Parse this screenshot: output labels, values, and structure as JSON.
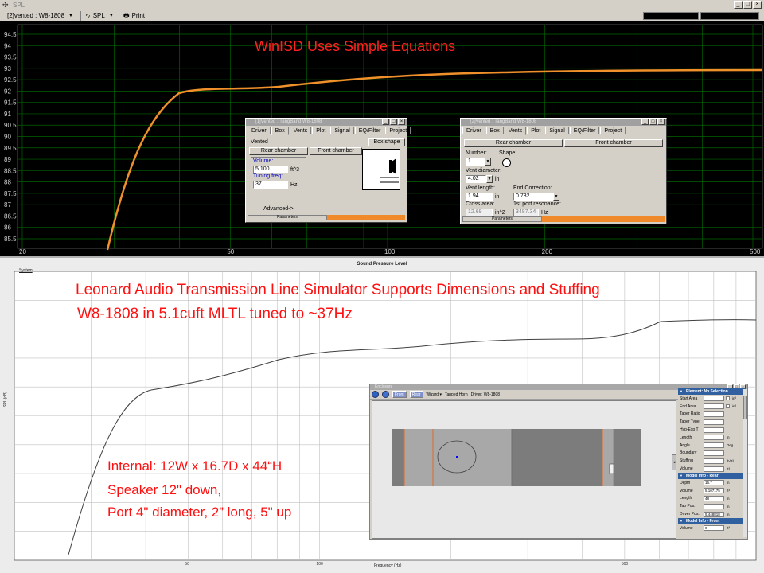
{
  "winisd": {
    "window_title": "SPL",
    "toolbar": {
      "project_combo": "[2]vented : W8-1808",
      "graph_combo": "SPL",
      "print_label": "Print"
    },
    "heading": "WinISD Uses Simple Equations",
    "plot": {
      "y_ticks": [
        "94.5",
        "94",
        "93.5",
        "93",
        "92.5",
        "92",
        "91.5",
        "91",
        "90.5",
        "90",
        "89.5",
        "89",
        "88.5",
        "88",
        "87.5",
        "87",
        "86.5",
        "86",
        "85.5"
      ],
      "x_ticks": [
        "20",
        "50",
        "100",
        "200",
        "500"
      ]
    },
    "dialog1": {
      "title": "[1]Vented : TangBand W8-1808",
      "tabs": [
        "Driver",
        "Box",
        "Vents",
        "Plot",
        "Signal",
        "EQ/Filter",
        "Project"
      ],
      "active_tab": "Box",
      "box_type": "Vented",
      "box_shape_button": "Box shape",
      "rear_chamber": "Rear chamber",
      "front_chamber": "Front chamber",
      "volume_label": "Volume:",
      "volume_value": "5.100",
      "volume_unit": "ft^3",
      "tuning_label": "Tuning freq:",
      "tuning_value": "37",
      "tuning_unit": "Hz",
      "advanced_button": "Advanced->",
      "status": "Parameters"
    },
    "dialog2": {
      "title": "[2]Vented : TangBand W8-1808",
      "tabs": [
        "Driver",
        "Box",
        "Vents",
        "Plot",
        "Signal",
        "EQ/Filter",
        "Project"
      ],
      "active_tab": "Vents",
      "rear_chamber": "Rear chamber",
      "front_chamber": "Front chamber",
      "number_label": "Number:",
      "number_value": "1",
      "shape_label": "Shape:",
      "vent_diameter_label": "Vent diameter:",
      "vent_diameter_value": "4.02",
      "vent_diameter_unit": "in",
      "vent_length_label": "Vent length:",
      "vent_length_value": "1.94",
      "vent_length_unit": "in",
      "end_correction_label": "End Correction:",
      "end_correction_value": "0.732",
      "cross_area_label": "Cross area:",
      "cross_area_value": "12.69",
      "cross_area_unit": "in^2",
      "port_resonance_label": "1st port resonance:",
      "port_resonance_value": "3487.34",
      "port_resonance_unit": "Hz",
      "status": "Parameters"
    }
  },
  "leonard": {
    "chart_title": "Sound Pressure Level",
    "system_label": "System",
    "heading_line1": "Leonard Audio Transmission Line Simulator Supports Dimensions and Stuffing",
    "heading_line2": "W8-1808 in 5.1cuft MLTL tuned to ~37Hz",
    "spec_lines": [
      "Internal: 12W x 16.7D x 44“H",
      "Speaker 12\" down,",
      "Port 4\" diameter, 2” long, 5\" up"
    ],
    "y_axis_label": "SPL (dB)",
    "x_axis_label": "Frequency (Hz)",
    "x_ticks": [
      "50",
      "100",
      "500"
    ],
    "enclosure": {
      "window_title": "Enclosure",
      "toolbar": [
        "Front",
        "Rear",
        "Wizard",
        "Tapped Horn",
        "Driver: W8-1808"
      ],
      "active_buttons": [
        "Front",
        "Rear"
      ],
      "element_header": "Element: No Selection",
      "element_rows": [
        {
          "k": "Start Area",
          "v": "",
          "u": "in²"
        },
        {
          "k": "End Area",
          "v": "",
          "u": "in²"
        },
        {
          "k": "Taper Ratio",
          "v": "",
          "u": ""
        },
        {
          "k": "Taper Type",
          "v": "",
          "u": ""
        },
        {
          "k": "Hyp-Exp T",
          "v": "",
          "u": ""
        },
        {
          "k": "Length",
          "v": "",
          "u": "in"
        },
        {
          "k": "Angle",
          "v": "",
          "u": "Deg"
        },
        {
          "k": "Boundary",
          "v": "",
          "u": ""
        },
        {
          "k": "Stuffing",
          "v": "",
          "u": "lb/ft³"
        },
        {
          "k": "Volume",
          "v": "",
          "u": "ft³"
        }
      ],
      "model_rear_header": "Model Info - Rear",
      "model_rear_rows": [
        {
          "k": "Depth",
          "v": "16.7",
          "u": "in"
        },
        {
          "k": "Volume",
          "v": "5.107175",
          "u": "ft³"
        },
        {
          "k": "Length",
          "v": "48",
          "u": "in"
        },
        {
          "k": "Tap Pos.",
          "v": "",
          "u": "in"
        },
        {
          "k": "Driver Pos.",
          "v": "9.448818",
          "u": "in"
        }
      ],
      "model_front_header": "Model Info - Front",
      "model_front_rows": [
        {
          "k": "Volume",
          "v": "0",
          "u": "ft³"
        }
      ]
    }
  }
}
